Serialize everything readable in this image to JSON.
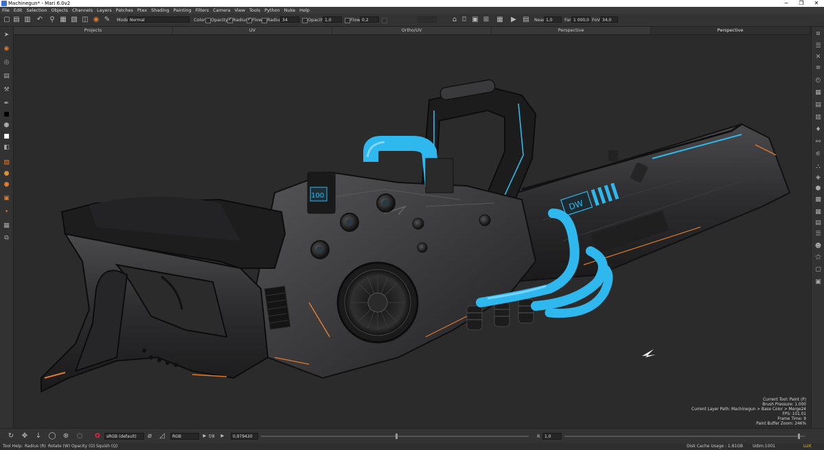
{
  "window": {
    "title": "Machinegun* - Mari 6.0v2",
    "minimize": "─",
    "maximize": "❐",
    "close": "✕"
  },
  "menu": [
    "File",
    "Edit",
    "Selection",
    "Objects",
    "Channels",
    "Layers",
    "Patches",
    "Ptex",
    "Shading",
    "Painting",
    "Filters",
    "Camera",
    "View",
    "Tools",
    "Python",
    "Nuke",
    "Help"
  ],
  "toolbar": {
    "mode_label": "Mode",
    "mode_value": "Normal",
    "color_label": "Color",
    "opacity_label": "Opacity",
    "radius_label": "Radius",
    "flow_label": "Flow",
    "radius_field_label": "Radius",
    "radius_value": "34",
    "opacity_field_label": "Opacity",
    "opacity_value": "1,0",
    "flow_field_label": "Flow",
    "flow_value": "0,2",
    "near_label": "Near",
    "near_value": "1,0",
    "far_label": "Far",
    "far_value": "1 000,0",
    "fov_label": "FoV",
    "fov_value": "34,0"
  },
  "tabs": [
    "Projects",
    "UV",
    "Ortho/UV",
    "Perspective",
    "Perspective"
  ],
  "active_tab_index": 4,
  "hud": {
    "current_tool": "Current Tool: Paint (P)",
    "brush_pressure": "Brush Pressure: 1.000",
    "layer_path": "Current Layer Path: Machinegun > Base Color > Merge24",
    "fps": "FPS: 101.01",
    "frame_time": "Frame Time: 9",
    "zoom": "Paint Buffer Zoom: 246%"
  },
  "model_decals": {
    "lcd": "100",
    "barrel": "DW"
  },
  "bottombar": {
    "colorspace": "sRGB (default)",
    "channel": "RGB",
    "fstop": "f/8",
    "gain": "0,979420",
    "r_label": "R",
    "r_value": "1,0"
  },
  "status": {
    "help_label": "Tool Help:",
    "radius_hint": "Radius (R)",
    "rotate_hint": "Rotate (W)",
    "opacity_hint": "Opacity (O)",
    "squish_hint": "Squish (Q)",
    "disk_cache": "Disk Cache Usage : 1.81GB",
    "udim": "Udim:1001",
    "lux": "LUX"
  },
  "colors": {
    "accent_cyan": "#2fb8ee",
    "accent_orange": "#e07a2e",
    "bg": "#2b2b2b"
  }
}
